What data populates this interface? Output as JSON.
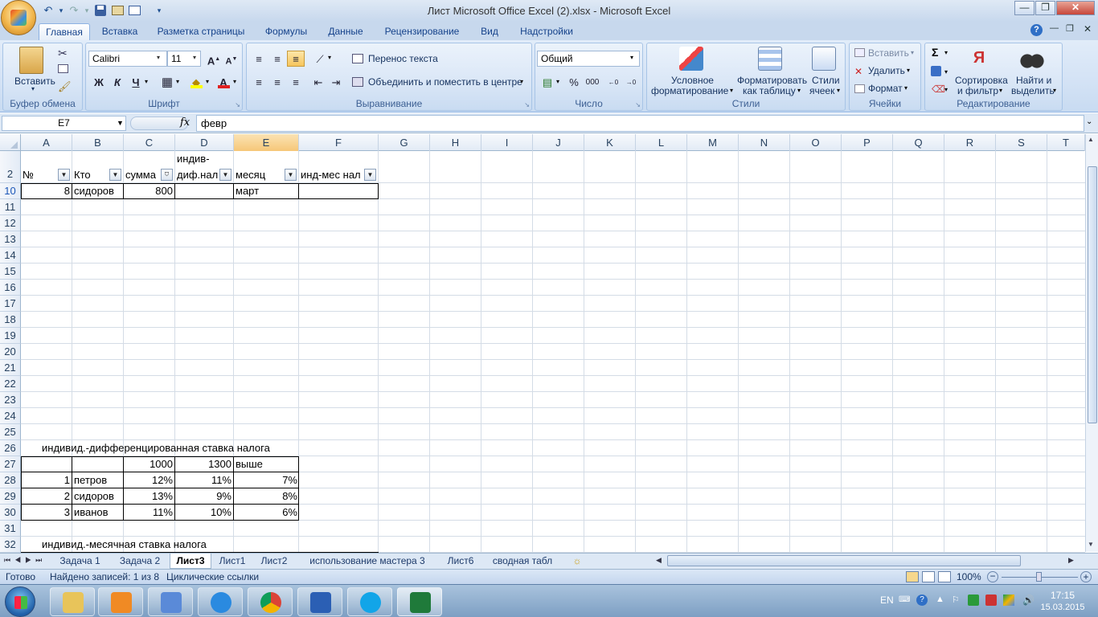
{
  "window": {
    "title": "Лист Microsoft Office Excel (2).xlsx - Microsoft Excel"
  },
  "ribbon_tabs": [
    "Главная",
    "Вставка",
    "Разметка страницы",
    "Формулы",
    "Данные",
    "Рецензирование",
    "Вид",
    "Надстройки"
  ],
  "clipboard": {
    "paste": "Вставить",
    "label": "Буфер обмена"
  },
  "font": {
    "name": "Calibri",
    "size": "11",
    "label": "Шрифт",
    "bold": "Ж",
    "italic": "К",
    "underline": "Ч"
  },
  "alignment": {
    "wrap": "Перенос текста",
    "merge": "Объединить и поместить в центре",
    "label": "Выравнивание"
  },
  "number": {
    "format": "Общий",
    "label": "Число",
    "percent": "%",
    "thousands": "000"
  },
  "styles": {
    "conditional": [
      "Условное",
      "форматирование"
    ],
    "table": [
      "Форматировать",
      "как таблицу"
    ],
    "cell": [
      "Стили",
      "ячеек"
    ],
    "label": "Стили"
  },
  "cells": {
    "insert": "Вставить",
    "delete": "Удалить",
    "format": "Формат",
    "label": "Ячейки"
  },
  "editing": {
    "sort": [
      "Сортировка",
      "и фильтр"
    ],
    "find": [
      "Найти и",
      "выделить"
    ],
    "label": "Редактирование",
    "sum": "Σ"
  },
  "formula_bar": {
    "name_box": "E7",
    "fx": "fx",
    "value": "февр"
  },
  "columns": [
    "A",
    "B",
    "C",
    "D",
    "E",
    "F",
    "G",
    "H",
    "I",
    "J",
    "K",
    "L",
    "M",
    "N",
    "O",
    "P",
    "Q",
    "R",
    "S",
    "T"
  ],
  "rows": [
    "2",
    "10",
    "11",
    "12",
    "13",
    "14",
    "15",
    "16",
    "17",
    "18",
    "19",
    "20",
    "21",
    "22",
    "23",
    "24",
    "25",
    "26",
    "27",
    "28",
    "29",
    "30",
    "31",
    "32"
  ],
  "header_row": {
    "a": "№",
    "b": "Кто",
    "c": "сумма",
    "d1": "индив-",
    "d2": "диф.нал",
    "e": "месяц",
    "f": "инд-мес нал"
  },
  "row10": {
    "a": "8",
    "b": "сидоров",
    "c": "800",
    "e": "март"
  },
  "table1": {
    "title": "индивид.-дифференцированная ставка налога",
    "head": [
      "",
      "",
      "1000",
      "1300",
      "выше"
    ],
    "rows": [
      [
        "1",
        "петров",
        "12%",
        "11%",
        "7%"
      ],
      [
        "2",
        "сидоров",
        "13%",
        "9%",
        "8%"
      ],
      [
        "3",
        "иванов",
        "11%",
        "10%",
        "6%"
      ]
    ]
  },
  "table2": {
    "title": "индивид.-месячная ставка налога"
  },
  "sheet_tabs": [
    "Задача 1",
    "Задача 2",
    "Лист3",
    "Лист1",
    "Лист2",
    "использование мастера 3",
    "Лист6",
    "сводная табл"
  ],
  "active_sheet": "Лист3",
  "status": {
    "ready": "Готово",
    "found": "Найдено записей: 1 из 8",
    "circular": "Циклические ссылки",
    "zoom": "100%"
  },
  "taskbar": {
    "lang": "EN",
    "time": "17:15",
    "date": "15.03.2015"
  },
  "colors": {
    "ribbon_bg": "#d3e2f5",
    "accent": "#15428b",
    "active_col": "#f9d99f"
  }
}
